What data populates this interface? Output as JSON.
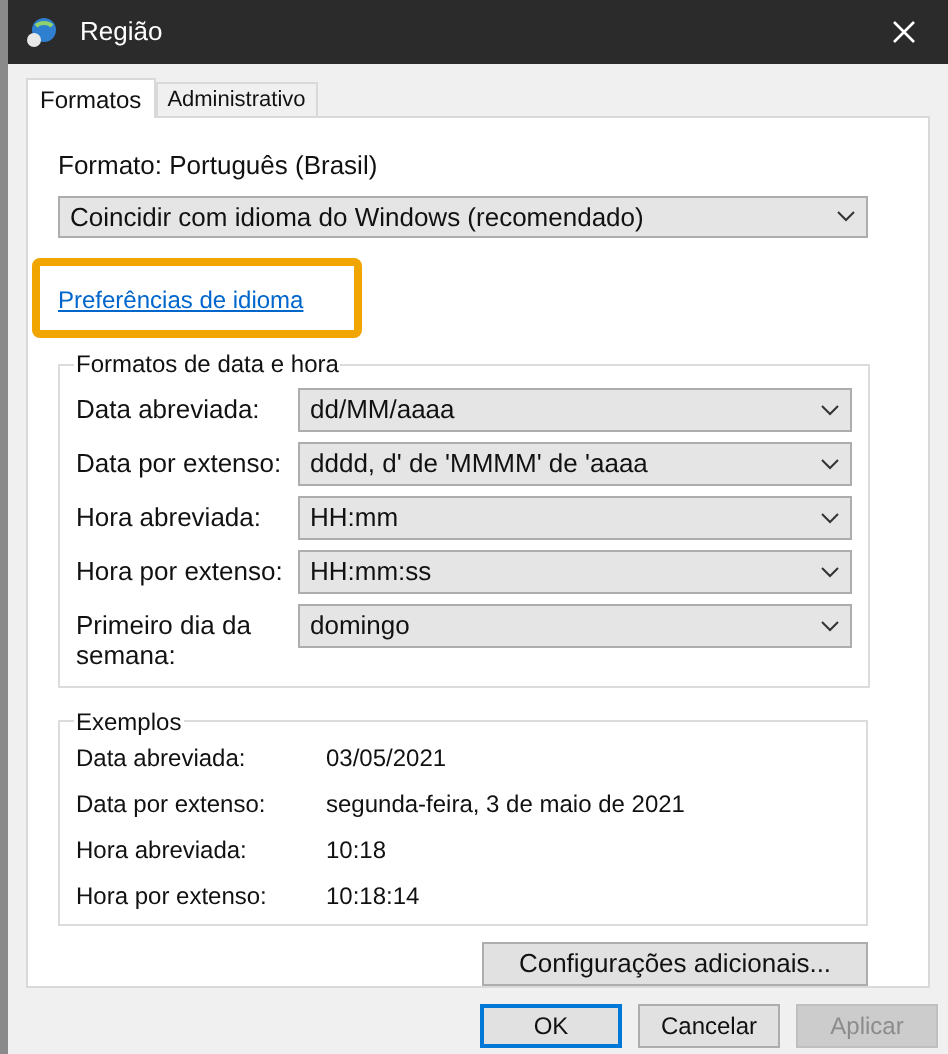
{
  "window": {
    "title": "Região"
  },
  "tabs": [
    {
      "label": "Formatos",
      "selected": true
    },
    {
      "label": "Administrativo",
      "selected": false
    }
  ],
  "format_label": "Formato: Português (Brasil)",
  "format_dropdown": {
    "value": "Coincidir com idioma do Windows (recomendado)"
  },
  "language_link": {
    "label": "Preferências de idioma",
    "highlighted": true
  },
  "date_time_formats": {
    "title": "Formatos de data e hora",
    "rows": [
      {
        "label": "Data abreviada:",
        "value": "dd/MM/aaaa"
      },
      {
        "label": "Data por extenso:",
        "value": "dddd, d' de 'MMMM' de 'aaaa"
      },
      {
        "label": "Hora abreviada:",
        "value": "HH:mm"
      },
      {
        "label": "Hora por extenso:",
        "value": "HH:mm:ss"
      },
      {
        "label": "Primeiro dia da semana:",
        "value": "domingo"
      }
    ]
  },
  "examples": {
    "title": "Exemplos",
    "rows": [
      {
        "label": "Data abreviada:",
        "value": "03/05/2021"
      },
      {
        "label": "Data por extenso:",
        "value": "segunda-feira, 3 de maio de 2021"
      },
      {
        "label": "Hora abreviada:",
        "value": "10:18"
      },
      {
        "label": "Hora por extenso:",
        "value": "10:18:14"
      }
    ]
  },
  "additional_settings_button": "Configurações adicionais...",
  "dialog_buttons": [
    {
      "label": "OK",
      "default": true,
      "disabled": false
    },
    {
      "label": "Cancelar",
      "default": false,
      "disabled": false
    },
    {
      "label": "Aplicar",
      "default": false,
      "disabled": true
    }
  ]
}
